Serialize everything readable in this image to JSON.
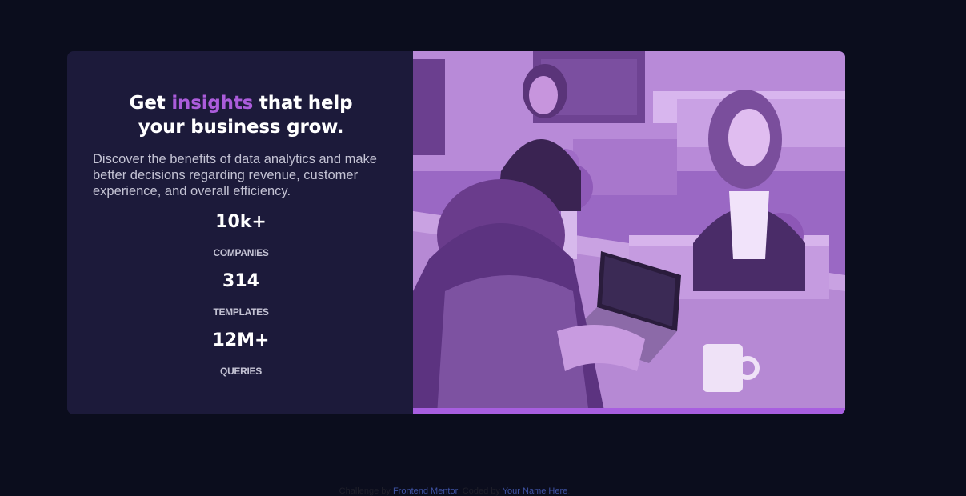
{
  "hero": {
    "title_pre": "Get ",
    "title_accent": "insights",
    "title_post": " that help",
    "title_line2": "your business grow.",
    "description": "Discover the benefits of data analytics and make better decisions regarding revenue, customer experience, and overall efficiency."
  },
  "stats": [
    {
      "value": "10k+",
      "label": "COMPANIES"
    },
    {
      "value": "314",
      "label": "TEMPLATES"
    },
    {
      "value": "12M+",
      "label": "QUERIES"
    }
  ],
  "attribution": {
    "challenge_text": "Challenge by ",
    "challenge_link": "Frontend Mentor",
    "coded_text": ". Coded by ",
    "author_link": "Your Name Here",
    "end": "."
  },
  "colors": {
    "page_background": "#0b0d1d",
    "card_background": "#1c1a3a",
    "accent": "#ab5cdb",
    "text_primary": "#ffffff",
    "text_secondary": "#c4c3d4",
    "image_overlay": "#8f5bb8",
    "link": "#3e52a3"
  }
}
